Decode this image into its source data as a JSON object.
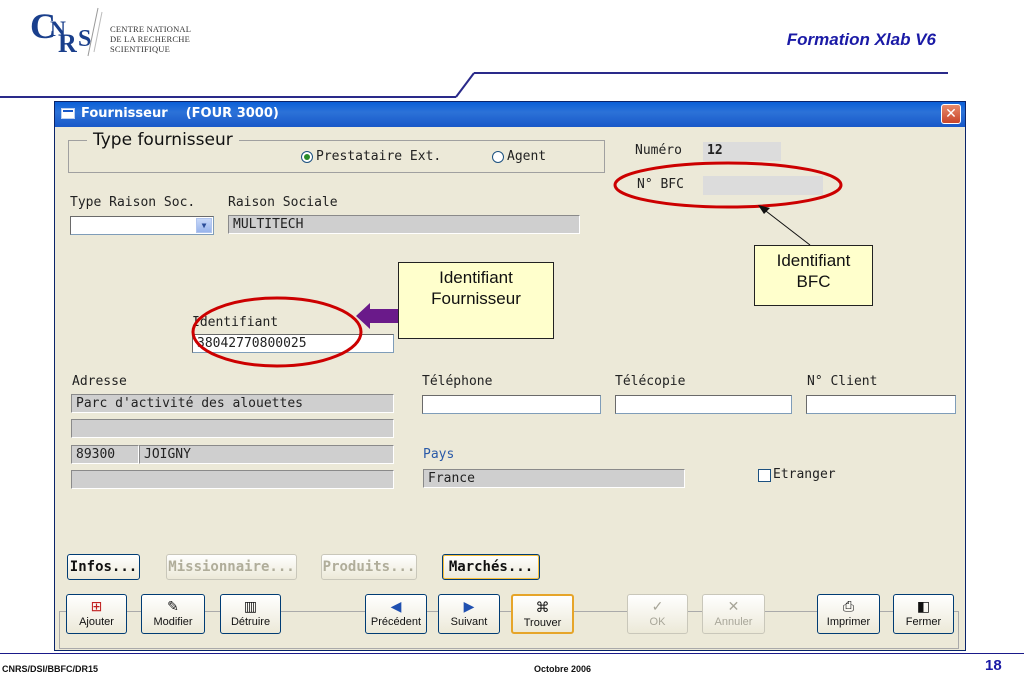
{
  "slide": {
    "org_lines": [
      "CENTRE NATIONAL",
      "DE LA RECHERCHE",
      "SCIENTIFIQUE"
    ],
    "title": "Formation Xlab V6",
    "footer_left": "CNRS/DSI/BBFC/DR15",
    "footer_center": "Octobre 2006",
    "page_number": "18",
    "logo_text": "CNRS"
  },
  "window": {
    "title": "Fournisseur    (FOUR 3000)",
    "close_label": "✕"
  },
  "form": {
    "type_fournisseur": {
      "legend": "Type fournisseur",
      "options": [
        "Prestataire Ext.",
        "Agent"
      ],
      "selected": "Prestataire Ext."
    },
    "numero_label": "Numéro",
    "numero_value": "12",
    "bfc_label": "N° BFC",
    "bfc_value": "",
    "type_raison_label": "Type Raison Soc.",
    "type_raison_value": "",
    "raison_label": "Raison Sociale",
    "raison_value": "MULTITECH",
    "identifiant_label": "Identifiant",
    "identifiant_value": "38042770800025",
    "adresse_label": "Adresse",
    "adresse_line1": "Parc d'activité des alouettes",
    "adresse_line2": "",
    "code_postal": "89300",
    "ville": "JOIGNY",
    "adresse_line4": "",
    "telephone_label": "Téléphone",
    "telephone_value": "",
    "telecopie_label": "Télécopie",
    "telecopie_value": "",
    "client_label": "N° Client",
    "client_value": "",
    "pays_label": "Pays",
    "pays_value": "France",
    "etranger_label": "Etranger",
    "etranger_checked": false,
    "accent_color": "#2a5aa8"
  },
  "action_buttons": [
    {
      "label": "Infos...",
      "enabled": true
    },
    {
      "label": "Missionnaire...",
      "enabled": false
    },
    {
      "label": "Produits...",
      "enabled": false
    },
    {
      "label": "Marchés...",
      "enabled": true
    }
  ],
  "toolbar": [
    {
      "label": "Ajouter",
      "icon": "add-icon",
      "enabled": true
    },
    {
      "label": "Modifier",
      "icon": "edit-icon",
      "enabled": true
    },
    {
      "label": "Détruire",
      "icon": "trash-icon",
      "enabled": true
    },
    {
      "label": "Précédent",
      "icon": "previous-icon",
      "enabled": true
    },
    {
      "label": "Suivant",
      "icon": "next-icon",
      "enabled": true
    },
    {
      "label": "Trouver",
      "icon": "binoculars-icon",
      "enabled": true
    },
    {
      "label": "OK",
      "icon": "check-icon",
      "enabled": false
    },
    {
      "label": "Annuler",
      "icon": "cancel-icon",
      "enabled": false
    },
    {
      "label": "Imprimer",
      "icon": "printer-icon",
      "enabled": true
    },
    {
      "label": "Fermer",
      "icon": "exit-door-icon",
      "enabled": true
    }
  ],
  "annotations": {
    "fournisseur_line1": "Identifiant",
    "fournisseur_line2": "Fournisseur",
    "bfc_line1": "Identifiant",
    "bfc_line2": "BFC",
    "highlight_color": "#cc0000"
  }
}
